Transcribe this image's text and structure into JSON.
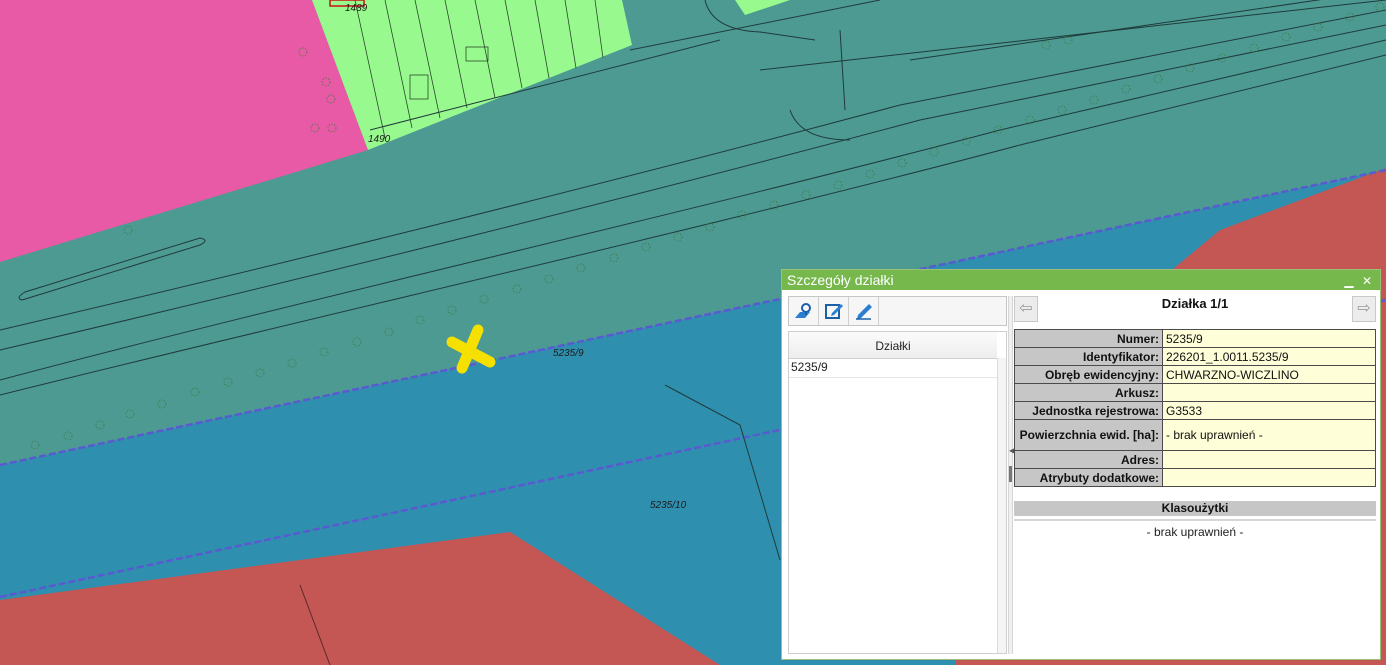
{
  "map": {
    "parcel_labels": [
      "5235/9",
      "5235/10",
      "1489",
      "1490"
    ],
    "colors": {
      "residential": "#e85aa5",
      "green_area": "#98f98e",
      "road": "#4d9a93",
      "parcel_blue": "#2f8fae",
      "parcel_red": "#c45654",
      "marker": "#f5e000"
    },
    "marker_icon": "yellow-cross-marker"
  },
  "panel": {
    "title": "Szczegóły działki",
    "minimize_glyph": "▁",
    "close_glyph": "✕",
    "tools": [
      "locate-parcel-icon",
      "edit-form-icon",
      "edit-pen-icon"
    ],
    "list_header": "Działki",
    "list_items": [
      "5235/9"
    ],
    "nav_title": "Działka 1/1",
    "prev_glyph": "⇦",
    "next_glyph": "⇨",
    "attributes": [
      {
        "key": "Numer:",
        "value": "5235/9"
      },
      {
        "key": "Identyfikator:",
        "value": "226201_1.0011.5235/9"
      },
      {
        "key": "Obręb ewidencyjny:",
        "value": "CHWARZNO-WICZLINO"
      },
      {
        "key": "Arkusz:",
        "value": ""
      },
      {
        "key": "Jednostka rejestrowa:",
        "value": "G3533"
      },
      {
        "key": "Powierzchnia ewid. [ha]:",
        "value": "- brak uprawnień -"
      },
      {
        "key": "Adres:",
        "value": ""
      },
      {
        "key": "Atrybuty dodatkowe:",
        "value": ""
      }
    ],
    "section_title": "Klasoużytki",
    "section_value": "- brak uprawnień -"
  }
}
